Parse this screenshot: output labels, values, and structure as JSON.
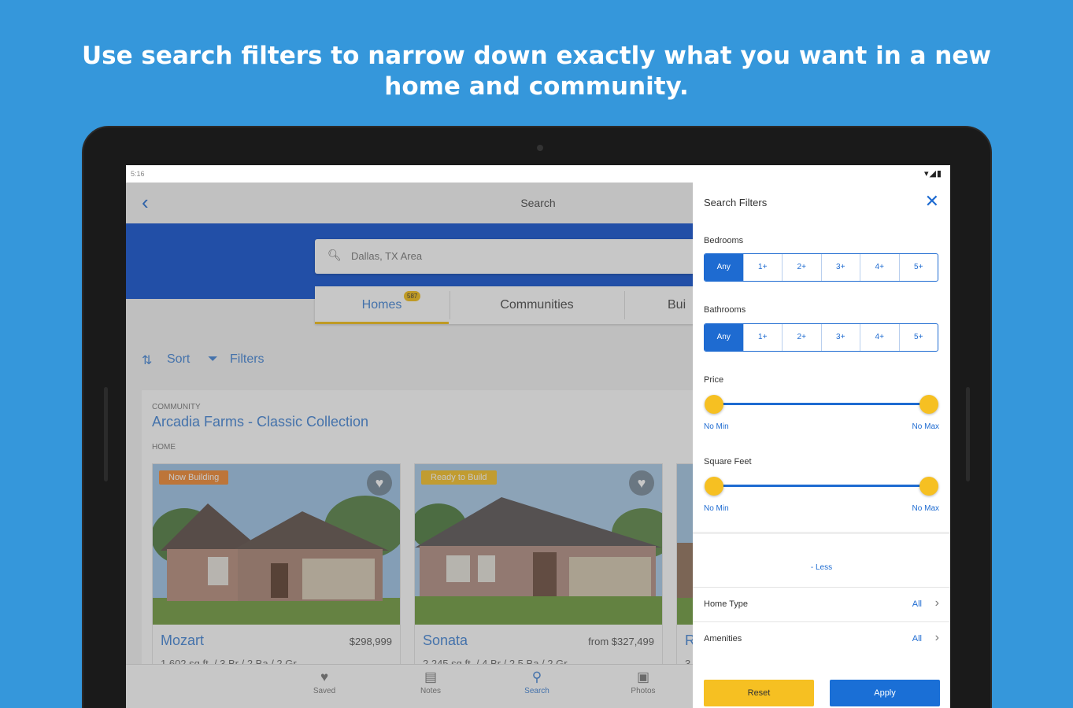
{
  "headline": "Use search filters to narrow down exactly what you want in a new home and community.",
  "status_bar": {
    "time": "5:16",
    "icons": "▾◢▮"
  },
  "app": {
    "title": "Search",
    "search_placeholder": "Dallas, TX Area",
    "tabs": [
      {
        "label": "Homes",
        "badge": "587",
        "active": true
      },
      {
        "label": "Communities",
        "active": false
      },
      {
        "label": "Bui",
        "active": false
      }
    ],
    "sort_label": "Sort",
    "filters_label": "Filters",
    "community_label": "COMMUNITY",
    "community_name": "Arcadia Farms - Classic Collection",
    "home_label": "HOME",
    "homes": [
      {
        "status": "Now Building",
        "status_color": "#f0872f",
        "name": "Mozart",
        "price": "$298,999",
        "details": "1,602 sq.ft. / 3 Br / 2 Ba / 2 Gr"
      },
      {
        "status": "Ready to Build",
        "status_color": "#f6c022",
        "name": "Sonata",
        "price": "from $327,499",
        "details": "2,245 sq.ft. / 4 Br / 2.5 Ba / 2 Gr"
      },
      {
        "name": "R",
        "details": "3"
      }
    ],
    "bottom_nav": [
      {
        "label": "Saved",
        "icon": "heart-icon",
        "active": false
      },
      {
        "label": "Notes",
        "icon": "notes-icon",
        "active": false
      },
      {
        "label": "Search",
        "icon": "search-icon",
        "active": true
      },
      {
        "label": "Photos",
        "icon": "photos-icon",
        "active": false
      }
    ]
  },
  "filters": {
    "title": "Search Filters",
    "bedrooms_label": "Bedrooms",
    "bedrooms_options": [
      "Any",
      "1+",
      "2+",
      "3+",
      "4+",
      "5+"
    ],
    "bedrooms_selected": "Any",
    "bathrooms_label": "Bathrooms",
    "bathrooms_options": [
      "Any",
      "1+",
      "2+",
      "3+",
      "4+",
      "5+"
    ],
    "bathrooms_selected": "Any",
    "price_label": "Price",
    "price_min": "No Min",
    "price_max": "No Max",
    "sqft_label": "Square Feet",
    "sqft_min": "No Min",
    "sqft_max": "No Max",
    "less_label": "- Less",
    "home_type_label": "Home Type",
    "home_type_value": "All",
    "amenities_label": "Amenities",
    "amenities_value": "All",
    "reset_label": "Reset",
    "apply_label": "Apply"
  },
  "colors": {
    "background": "#3597db",
    "brand_blue": "#0c4fd0",
    "accent_yellow": "#f6c022",
    "link_blue": "#1e6bd1"
  }
}
